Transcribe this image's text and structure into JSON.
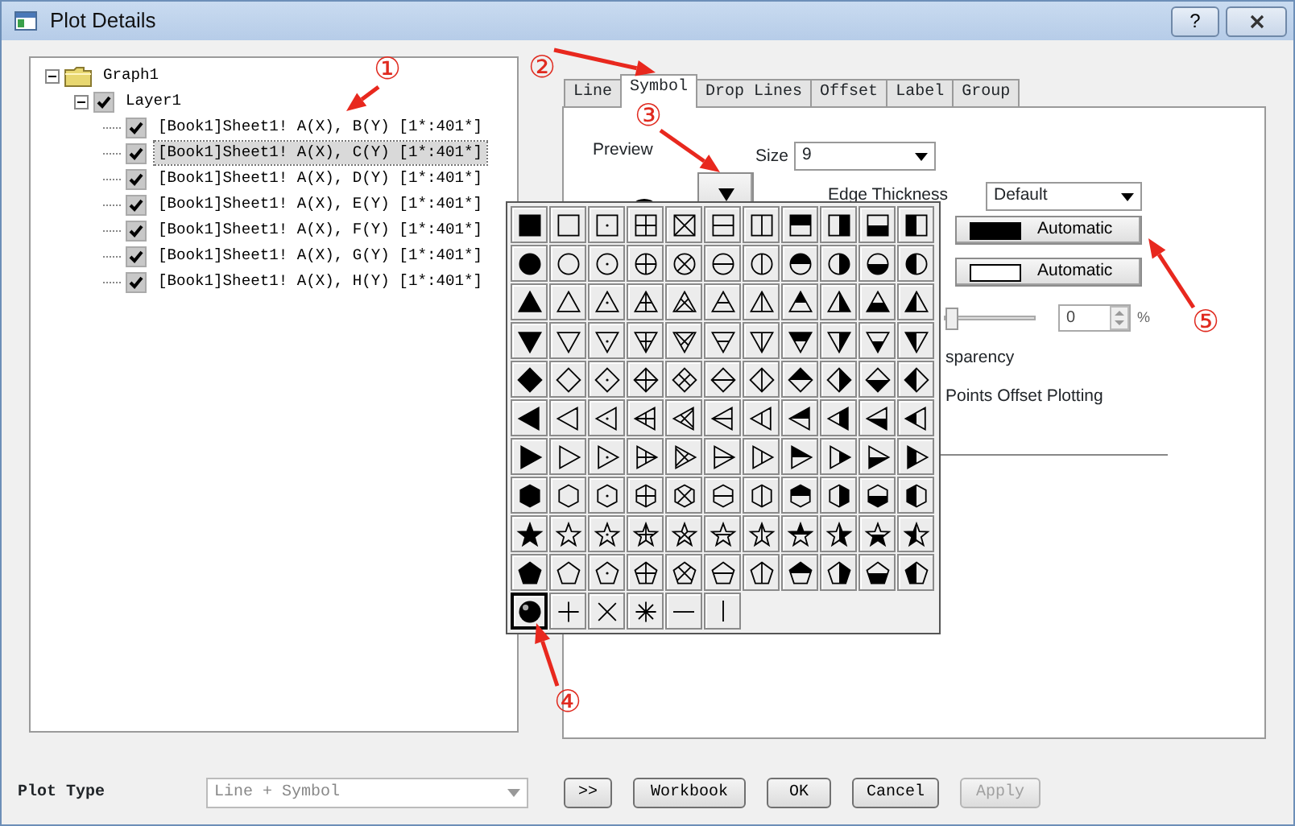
{
  "window": {
    "title": "Plot Details",
    "help_button": "?"
  },
  "tree": [
    {
      "kind": "graph",
      "label": "Graph1",
      "expanded": true,
      "children": [
        {
          "kind": "layer",
          "label": "Layer1",
          "checked": true,
          "expanded": true,
          "children": [
            {
              "kind": "plot",
              "label": "[Book1]Sheet1! A(X), B(Y) [1*:401*]",
              "checked": true,
              "selected": false
            },
            {
              "kind": "plot",
              "label": "[Book1]Sheet1! A(X), C(Y) [1*:401*]",
              "checked": true,
              "selected": true
            },
            {
              "kind": "plot",
              "label": "[Book1]Sheet1! A(X), D(Y) [1*:401*]",
              "checked": true,
              "selected": false
            },
            {
              "kind": "plot",
              "label": "[Book1]Sheet1! A(X), E(Y) [1*:401*]",
              "checked": true,
              "selected": false
            },
            {
              "kind": "plot",
              "label": "[Book1]Sheet1! A(X), F(Y) [1*:401*]",
              "checked": true,
              "selected": false
            },
            {
              "kind": "plot",
              "label": "[Book1]Sheet1! A(X), G(Y) [1*:401*]",
              "checked": true,
              "selected": false
            },
            {
              "kind": "plot",
              "label": "[Book1]Sheet1! A(X), H(Y) [1*:401*]",
              "checked": true,
              "selected": false
            }
          ]
        }
      ]
    }
  ],
  "tabs": [
    {
      "label": "Line",
      "selected": false
    },
    {
      "label": "Symbol",
      "selected": true
    },
    {
      "label": "Drop Lines",
      "selected": false
    },
    {
      "label": "Offset",
      "selected": false
    },
    {
      "label": "Label",
      "selected": false
    },
    {
      "label": "Group",
      "selected": false
    }
  ],
  "symbol_tab": {
    "preview_label": "Preview",
    "size_label": "Size",
    "size_value": "9",
    "edge_thickness_label": "Edge Thickness",
    "edge_thickness_value": "Default",
    "color_buttons": [
      {
        "label": "Automatic",
        "color": "#000000"
      },
      {
        "label": "Automatic",
        "color": "#ffffff"
      }
    ],
    "transparency": {
      "level": 0,
      "value": "0",
      "unit": "%"
    },
    "transparency_label": "sparency",
    "offset_label": "Points Offset Plotting"
  },
  "symbol_palette": {
    "rows": [
      {
        "cells": [
          {
            "selected": false
          },
          {
            "selected": false
          },
          {
            "selected": false
          },
          {
            "selected": false
          },
          {
            "selected": false
          },
          {
            "selected": false
          },
          {
            "selected": false
          },
          {
            "selected": false
          },
          {
            "selected": false
          },
          {
            "selected": false
          },
          {
            "selected": false
          }
        ]
      },
      {
        "cells": [
          {
            "selected": false
          },
          {
            "selected": false
          },
          {
            "selected": false
          },
          {
            "selected": false
          },
          {
            "selected": false
          },
          {
            "selected": false
          },
          {
            "selected": false
          },
          {
            "selected": false
          },
          {
            "selected": false
          },
          {
            "selected": false
          },
          {
            "selected": false
          }
        ]
      },
      {
        "cells": [
          {
            "selected": false
          },
          {
            "selected": false
          },
          {
            "selected": false
          },
          {
            "selected": false
          },
          {
            "selected": false
          },
          {
            "selected": false
          },
          {
            "selected": false
          },
          {
            "selected": false
          },
          {
            "selected": false
          },
          {
            "selected": false
          },
          {
            "selected": false
          }
        ]
      },
      {
        "cells": [
          {
            "selected": false
          },
          {
            "selected": false
          },
          {
            "selected": false
          },
          {
            "selected": false
          },
          {
            "selected": false
          },
          {
            "selected": false
          },
          {
            "selected": false
          },
          {
            "selected": false
          },
          {
            "selected": false
          },
          {
            "selected": false
          },
          {
            "selected": false
          }
        ]
      },
      {
        "cells": [
          {
            "selected": false
          },
          {
            "selected": false
          },
          {
            "selected": false
          },
          {
            "selected": false
          },
          {
            "selected": false
          },
          {
            "selected": false
          },
          {
            "selected": false
          },
          {
            "selected": false
          },
          {
            "selected": false
          },
          {
            "selected": false
          },
          {
            "selected": false
          }
        ]
      },
      {
        "cells": [
          {
            "selected": false
          },
          {
            "selected": false
          },
          {
            "selected": false
          },
          {
            "selected": false
          },
          {
            "selected": false
          },
          {
            "selected": false
          },
          {
            "selected": false
          },
          {
            "selected": false
          },
          {
            "selected": false
          },
          {
            "selected": false
          },
          {
            "selected": false
          }
        ]
      },
      {
        "cells": [
          {
            "selected": false
          },
          {
            "selected": false
          },
          {
            "selected": false
          },
          {
            "selected": false
          },
          {
            "selected": false
          },
          {
            "selected": false
          },
          {
            "selected": false
          },
          {
            "selected": false
          },
          {
            "selected": false
          },
          {
            "selected": false
          },
          {
            "selected": false
          }
        ]
      },
      {
        "cells": [
          {
            "selected": false
          },
          {
            "selected": false
          },
          {
            "selected": false
          },
          {
            "selected": false
          },
          {
            "selected": false
          },
          {
            "selected": false
          },
          {
            "selected": false
          },
          {
            "selected": false
          },
          {
            "selected": false
          },
          {
            "selected": false
          },
          {
            "selected": false
          }
        ]
      },
      {
        "cells": [
          {
            "selected": false
          },
          {
            "selected": false
          },
          {
            "selected": false
          },
          {
            "selected": false
          },
          {
            "selected": false
          },
          {
            "selected": false
          },
          {
            "selected": false
          },
          {
            "selected": false
          },
          {
            "selected": false
          },
          {
            "selected": false
          },
          {
            "selected": false
          }
        ]
      },
      {
        "cells": [
          {
            "selected": false
          },
          {
            "selected": false
          },
          {
            "selected": false
          },
          {
            "selected": false
          },
          {
            "selected": false
          },
          {
            "selected": false
          },
          {
            "selected": false
          },
          {
            "selected": false
          },
          {
            "selected": false
          },
          {
            "selected": false
          },
          {
            "selected": false
          }
        ]
      },
      {
        "cells": [
          {
            "selected": true
          },
          {
            "selected": false
          },
          {
            "selected": false
          },
          {
            "selected": false
          },
          {
            "selected": false
          },
          {
            "selected": false
          }
        ]
      }
    ]
  },
  "bottom_bar": {
    "plot_type_label": "Plot Type",
    "plot_type_value": "Line + Symbol",
    "buttons": [
      {
        "label": ">>",
        "disabled": false
      },
      {
        "label": "Workbook",
        "disabled": false
      },
      {
        "label": "OK",
        "disabled": false
      },
      {
        "label": "Cancel",
        "disabled": false
      },
      {
        "label": "Apply",
        "disabled": true
      }
    ]
  },
  "annotations": [
    {
      "label": "①"
    },
    {
      "label": "②"
    },
    {
      "label": "③"
    },
    {
      "label": "④"
    },
    {
      "label": "⑤"
    }
  ]
}
